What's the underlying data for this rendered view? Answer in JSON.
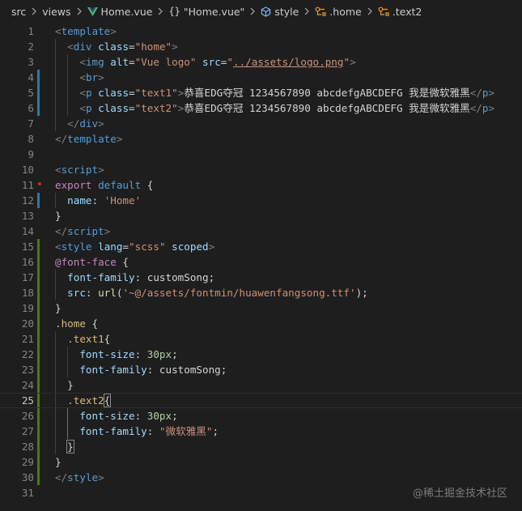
{
  "breadcrumb": {
    "items": [
      {
        "label": "src",
        "icon": ""
      },
      {
        "label": "views",
        "icon": ""
      },
      {
        "label": "Home.vue",
        "icon": "vue-icon"
      },
      {
        "label": "\"Home.vue\"",
        "icon": "braces-icon"
      },
      {
        "label": "style",
        "icon": "cube-icon"
      },
      {
        "label": ".home",
        "icon": "selector-icon"
      },
      {
        "label": ".text2",
        "icon": "selector-icon"
      }
    ],
    "icon_text": {
      "braces": "{}"
    }
  },
  "colors": {
    "background": "#1e1e1e",
    "vue_green": "#41b883",
    "gutter_modified": "#1b81a8",
    "gutter_added": "#487e02",
    "tag": "#569cd6",
    "attribute": "#9cdcfe",
    "string": "#ce9178",
    "selector": "#d7ba7d"
  },
  "editor": {
    "active_line": 25,
    "lines": [
      {
        "n": "1",
        "gutter": "",
        "tokens": [
          [
            "t-punc",
            "<"
          ],
          [
            "t-tag",
            "template"
          ],
          [
            "t-punc",
            ">"
          ]
        ]
      },
      {
        "n": "2",
        "gutter": "",
        "tokens": [
          [
            "t-plain",
            "  "
          ],
          [
            "t-punc",
            "<"
          ],
          [
            "t-tag",
            "div"
          ],
          [
            "t-plain",
            " "
          ],
          [
            "t-attr",
            "class"
          ],
          [
            "t-plain",
            "="
          ],
          [
            "t-str",
            "\"home\""
          ],
          [
            "t-punc",
            ">"
          ]
        ]
      },
      {
        "n": "3",
        "gutter": "",
        "tokens": [
          [
            "t-plain",
            "    "
          ],
          [
            "t-punc",
            "<"
          ],
          [
            "t-tag",
            "img"
          ],
          [
            "t-plain",
            " "
          ],
          [
            "t-attr",
            "alt"
          ],
          [
            "t-plain",
            "="
          ],
          [
            "t-str",
            "\"Vue logo\""
          ],
          [
            "t-plain",
            " "
          ],
          [
            "t-attr",
            "src"
          ],
          [
            "t-plain",
            "="
          ],
          [
            "t-str",
            "\""
          ],
          [
            "t-str t-ul",
            "../assets/logo.png"
          ],
          [
            "t-str",
            "\""
          ],
          [
            "t-punc",
            ">"
          ]
        ]
      },
      {
        "n": "4",
        "gutter": "blue",
        "tokens": [
          [
            "t-plain",
            "    "
          ],
          [
            "t-punc",
            "<"
          ],
          [
            "t-tag",
            "br"
          ],
          [
            "t-punc",
            ">"
          ]
        ]
      },
      {
        "n": "5",
        "gutter": "blue",
        "tokens": [
          [
            "t-plain",
            "    "
          ],
          [
            "t-punc",
            "<"
          ],
          [
            "t-tag",
            "p"
          ],
          [
            "t-plain",
            " "
          ],
          [
            "t-attr",
            "class"
          ],
          [
            "t-plain",
            "="
          ],
          [
            "t-str",
            "\"text1\""
          ],
          [
            "t-punc",
            ">"
          ],
          [
            "t-text",
            "恭喜EDG夺冠 1234567890 abcdefgABCDEFG 我是微软雅黑"
          ],
          [
            "t-punc",
            "</"
          ],
          [
            "t-tag",
            "p"
          ],
          [
            "t-punc",
            ">"
          ]
        ]
      },
      {
        "n": "6",
        "gutter": "blue",
        "tokens": [
          [
            "t-plain",
            "    "
          ],
          [
            "t-punc",
            "<"
          ],
          [
            "t-tag",
            "p"
          ],
          [
            "t-plain",
            " "
          ],
          [
            "t-attr",
            "class"
          ],
          [
            "t-plain",
            "="
          ],
          [
            "t-str",
            "\"text2\""
          ],
          [
            "t-punc",
            ">"
          ],
          [
            "t-text",
            "恭喜EDG夺冠 1234567890 abcdefgABCDEFG 我是微软雅黑"
          ],
          [
            "t-punc",
            "</"
          ],
          [
            "t-tag",
            "p"
          ],
          [
            "t-punc",
            ">"
          ]
        ]
      },
      {
        "n": "7",
        "gutter": "",
        "tokens": [
          [
            "t-plain",
            "  "
          ],
          [
            "t-punc",
            "</"
          ],
          [
            "t-tag",
            "div"
          ],
          [
            "t-punc",
            ">"
          ]
        ]
      },
      {
        "n": "8",
        "gutter": "",
        "tokens": [
          [
            "t-punc",
            "</"
          ],
          [
            "t-tag",
            "template"
          ],
          [
            "t-punc",
            ">"
          ]
        ]
      },
      {
        "n": "9",
        "gutter": "",
        "tokens": []
      },
      {
        "n": "10",
        "gutter": "",
        "tokens": [
          [
            "t-punc",
            "<"
          ],
          [
            "t-tag",
            "script"
          ],
          [
            "t-punc",
            ">"
          ]
        ]
      },
      {
        "n": "11",
        "gutter": "",
        "tokens": [
          [
            "t-at",
            "export"
          ],
          [
            "t-plain",
            " "
          ],
          [
            "t-kw",
            "default"
          ],
          [
            "t-plain",
            " {"
          ]
        ]
      },
      {
        "n": "12",
        "gutter": "blue",
        "tokens": [
          [
            "t-plain",
            "  "
          ],
          [
            "t-prop",
            "name"
          ],
          [
            "t-plain",
            ": "
          ],
          [
            "t-str",
            "'Home'"
          ]
        ]
      },
      {
        "n": "13",
        "gutter": "",
        "tokens": [
          [
            "t-plain",
            "}"
          ]
        ]
      },
      {
        "n": "14",
        "gutter": "",
        "tokens": [
          [
            "t-punc",
            "</"
          ],
          [
            "t-tag",
            "script"
          ],
          [
            "t-punc",
            ">"
          ]
        ]
      },
      {
        "n": "15",
        "gutter": "green",
        "tokens": [
          [
            "t-punc",
            "<"
          ],
          [
            "t-tag",
            "style"
          ],
          [
            "t-plain",
            " "
          ],
          [
            "t-attr",
            "lang"
          ],
          [
            "t-plain",
            "="
          ],
          [
            "t-str",
            "\"scss\""
          ],
          [
            "t-plain",
            " "
          ],
          [
            "t-attr",
            "scoped"
          ],
          [
            "t-punc",
            ">"
          ]
        ]
      },
      {
        "n": "16",
        "gutter": "green",
        "tokens": [
          [
            "t-at",
            "@font-face"
          ],
          [
            "t-plain",
            " {"
          ]
        ]
      },
      {
        "n": "17",
        "gutter": "green",
        "tokens": [
          [
            "t-plain",
            "  "
          ],
          [
            "t-prop",
            "font-family"
          ],
          [
            "t-plain",
            ": "
          ],
          [
            "t-plain",
            "customSong;"
          ]
        ]
      },
      {
        "n": "18",
        "gutter": "green",
        "tokens": [
          [
            "t-plain",
            "  "
          ],
          [
            "t-prop",
            "src"
          ],
          [
            "t-plain",
            ": "
          ],
          [
            "t-fn",
            "url"
          ],
          [
            "t-plain",
            "("
          ],
          [
            "t-str",
            "'~@/assets/fontmin/huawenfangsong.ttf'"
          ],
          [
            "t-plain",
            ");"
          ]
        ]
      },
      {
        "n": "19",
        "gutter": "green",
        "tokens": [
          [
            "t-plain",
            "}"
          ]
        ]
      },
      {
        "n": "20",
        "gutter": "green",
        "tokens": [
          [
            "t-sel",
            ".home"
          ],
          [
            "t-plain",
            " {"
          ]
        ]
      },
      {
        "n": "21",
        "gutter": "green",
        "tokens": [
          [
            "t-plain",
            "  "
          ],
          [
            "t-sel",
            ".text1"
          ],
          [
            "t-plain",
            "{"
          ]
        ]
      },
      {
        "n": "22",
        "gutter": "green",
        "tokens": [
          [
            "t-plain",
            "    "
          ],
          [
            "t-prop",
            "font-size"
          ],
          [
            "t-plain",
            ": "
          ],
          [
            "t-num",
            "30px"
          ],
          [
            "t-plain",
            ";"
          ]
        ]
      },
      {
        "n": "23",
        "gutter": "green",
        "tokens": [
          [
            "t-plain",
            "    "
          ],
          [
            "t-prop",
            "font-family"
          ],
          [
            "t-plain",
            ": "
          ],
          [
            "t-plain",
            "customSong;"
          ]
        ]
      },
      {
        "n": "24",
        "gutter": "green",
        "tokens": [
          [
            "t-plain",
            "  }"
          ]
        ]
      },
      {
        "n": "25",
        "gutter": "green",
        "tokens": [
          [
            "t-plain",
            "  "
          ],
          [
            "t-sel",
            ".text2"
          ],
          [
            "t-plain bracket-box",
            "{"
          ]
        ]
      },
      {
        "n": "26",
        "gutter": "green",
        "tokens": [
          [
            "t-plain",
            "    "
          ],
          [
            "t-prop",
            "font-size"
          ],
          [
            "t-plain",
            ": "
          ],
          [
            "t-num",
            "30px"
          ],
          [
            "t-plain",
            ";"
          ]
        ]
      },
      {
        "n": "27",
        "gutter": "green",
        "tokens": [
          [
            "t-plain",
            "    "
          ],
          [
            "t-prop",
            "font-family"
          ],
          [
            "t-plain",
            ": "
          ],
          [
            "t-str",
            "\"微软雅黑\""
          ],
          [
            "t-plain",
            ";"
          ]
        ]
      },
      {
        "n": "28",
        "gutter": "green",
        "tokens": [
          [
            "t-plain",
            "  "
          ],
          [
            "t-plain bracket-box",
            "}"
          ]
        ]
      },
      {
        "n": "29",
        "gutter": "green",
        "tokens": [
          [
            "t-plain",
            "}"
          ]
        ]
      },
      {
        "n": "30",
        "gutter": "green",
        "tokens": [
          [
            "t-punc",
            "</"
          ],
          [
            "t-tag",
            "style"
          ],
          [
            "t-punc",
            ">"
          ]
        ]
      },
      {
        "n": "31",
        "gutter": "",
        "tokens": []
      }
    ]
  },
  "watermark": "@稀土掘金技术社区"
}
